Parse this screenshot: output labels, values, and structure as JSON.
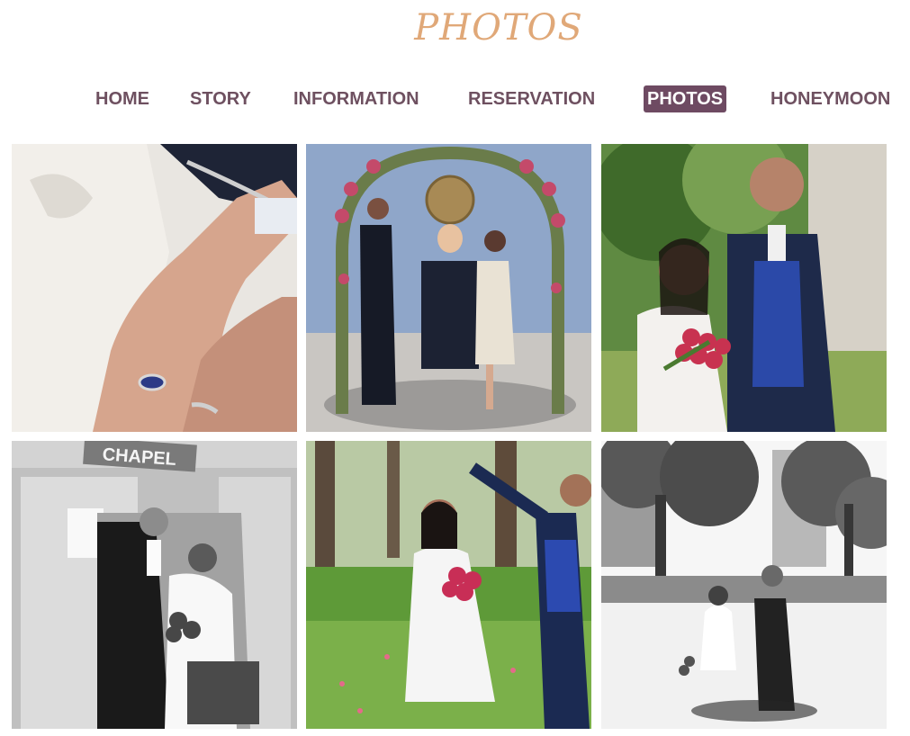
{
  "header": {
    "title": "PHOTOS"
  },
  "nav": {
    "items": [
      {
        "label": "HOME",
        "active": false
      },
      {
        "label": "STORY",
        "active": false
      },
      {
        "label": "INFORMATION",
        "active": false
      },
      {
        "label": "RESERVATION",
        "active": false
      },
      {
        "label": "PHOTOS",
        "active": true
      },
      {
        "label": "HONEYMOON",
        "active": false
      }
    ]
  },
  "gallery": {
    "photos": [
      {
        "subject": "hands with wedding rings",
        "style": "color"
      },
      {
        "subject": "ceremony under floral arch",
        "style": "color"
      },
      {
        "subject": "couple with red roses",
        "style": "color"
      },
      {
        "subject": "couple at chapel door",
        "style": "black-and-white",
        "sign": "CHAPEL"
      },
      {
        "subject": "petals thrown in park",
        "style": "color"
      },
      {
        "subject": "couple walking hand in hand",
        "style": "black-and-white"
      }
    ]
  },
  "colors": {
    "title": "#e0a878",
    "nav_text": "#6e5060",
    "nav_active_bg": "#6e4a62"
  }
}
